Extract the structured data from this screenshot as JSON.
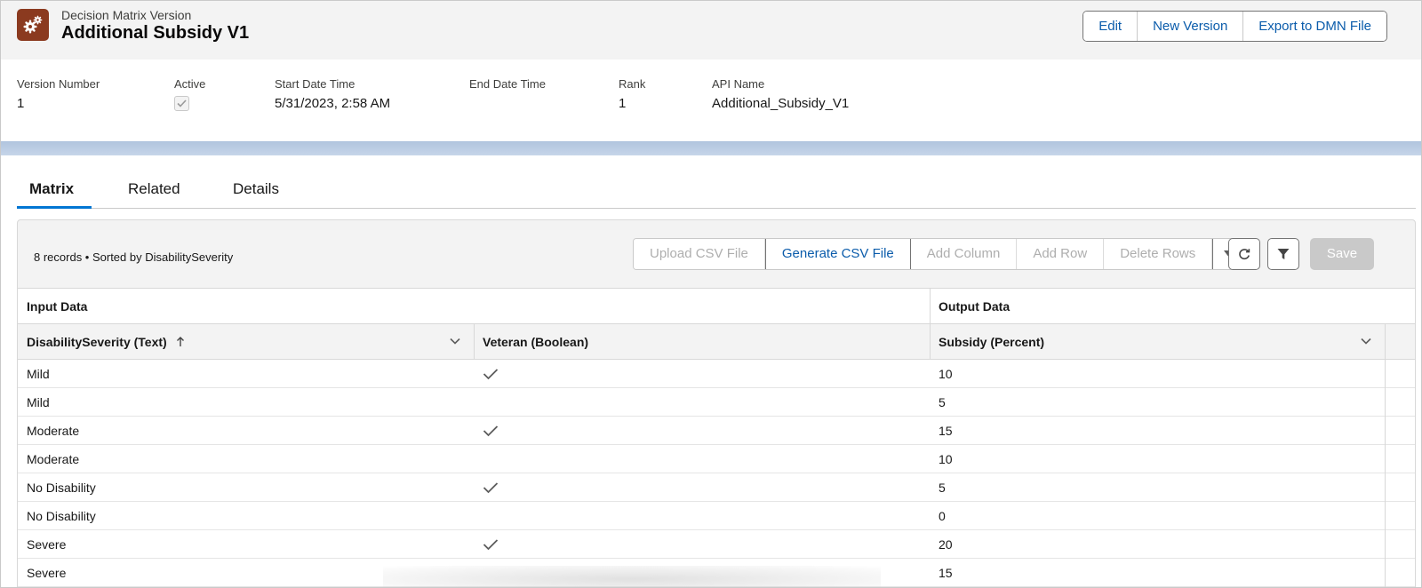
{
  "header": {
    "object_type": "Decision Matrix Version",
    "title": "Additional Subsidy V1",
    "actions": [
      "Edit",
      "New Version",
      "Export to DMN File"
    ]
  },
  "fields": {
    "version_number": {
      "label": "Version Number",
      "value": "1"
    },
    "active": {
      "label": "Active",
      "checked": true
    },
    "start_date_time": {
      "label": "Start Date Time",
      "value": "5/31/2023, 2:58 AM"
    },
    "end_date_time": {
      "label": "End Date Time",
      "value": ""
    },
    "rank": {
      "label": "Rank",
      "value": "1"
    },
    "api_name": {
      "label": "API Name",
      "value": "Additional_Subsidy_V1"
    }
  },
  "tabs": [
    {
      "label": "Matrix",
      "active": true
    },
    {
      "label": "Related",
      "active": false
    },
    {
      "label": "Details",
      "active": false
    }
  ],
  "matrix": {
    "record_info": "8 records • Sorted by DisabilitySeverity",
    "toolbar": {
      "upload": "Upload CSV File",
      "generate": "Generate CSV File",
      "add_column": "Add Column",
      "add_row": "Add Row",
      "delete_rows": "Delete Rows",
      "save": "Save"
    },
    "groups": {
      "input": "Input Data",
      "output": "Output Data"
    },
    "columns": {
      "severity": "DisabilitySeverity (Text)",
      "veteran": "Veteran (Boolean)",
      "subsidy": "Subsidy (Percent)"
    },
    "rows": [
      {
        "severity": "Mild",
        "veteran": true,
        "subsidy": "10"
      },
      {
        "severity": "Mild",
        "veteran": false,
        "subsidy": "5"
      },
      {
        "severity": "Moderate",
        "veteran": true,
        "subsidy": "15"
      },
      {
        "severity": "Moderate",
        "veteran": false,
        "subsidy": "10"
      },
      {
        "severity": "No Disability",
        "veteran": true,
        "subsidy": "5"
      },
      {
        "severity": "No Disability",
        "veteran": false,
        "subsidy": "0"
      },
      {
        "severity": "Severe",
        "veteran": true,
        "subsidy": "20"
      },
      {
        "severity": "Severe",
        "veteran": false,
        "subsidy": "15"
      }
    ]
  },
  "colors": {
    "brand_icon": "#8b3a1f",
    "link": "#0b5cab",
    "tab_active": "#0176d3"
  }
}
